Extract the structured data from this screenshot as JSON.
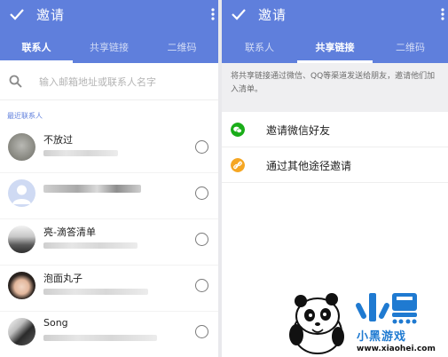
{
  "left_panel": {
    "title": "邀请",
    "tabs": [
      {
        "label": "联系人",
        "active": true
      },
      {
        "label": "共享链接",
        "active": false
      },
      {
        "label": "二维码",
        "active": false
      }
    ],
    "search_placeholder": "输入邮箱地址或联系人名字",
    "section_label": "最近联系人",
    "contacts": [
      {
        "name": "不放过"
      },
      {
        "name": ""
      },
      {
        "name": "亮-滴答清单"
      },
      {
        "name": "泡面丸子"
      },
      {
        "name": "Song"
      }
    ]
  },
  "right_panel": {
    "title": "邀请",
    "tabs": [
      {
        "label": "联系人",
        "active": false
      },
      {
        "label": "共享链接",
        "active": true
      },
      {
        "label": "二维码",
        "active": false
      }
    ],
    "info_text": "将共享链接通过微信、QQ等渠道发送给朋友，邀请他们加入清单。",
    "options": [
      {
        "label": "邀请微信好友",
        "icon": "wechat-icon",
        "color": "#1aad19"
      },
      {
        "label": "通过其他途径邀请",
        "icon": "link-icon",
        "color": "#f5a623"
      }
    ]
  },
  "watermark": {
    "brand": "小黑游戏",
    "site": "www.xiaohei.com"
  },
  "colors": {
    "accent": "#5f7fdc",
    "wechat": "#1aad19",
    "link": "#f5a623"
  }
}
